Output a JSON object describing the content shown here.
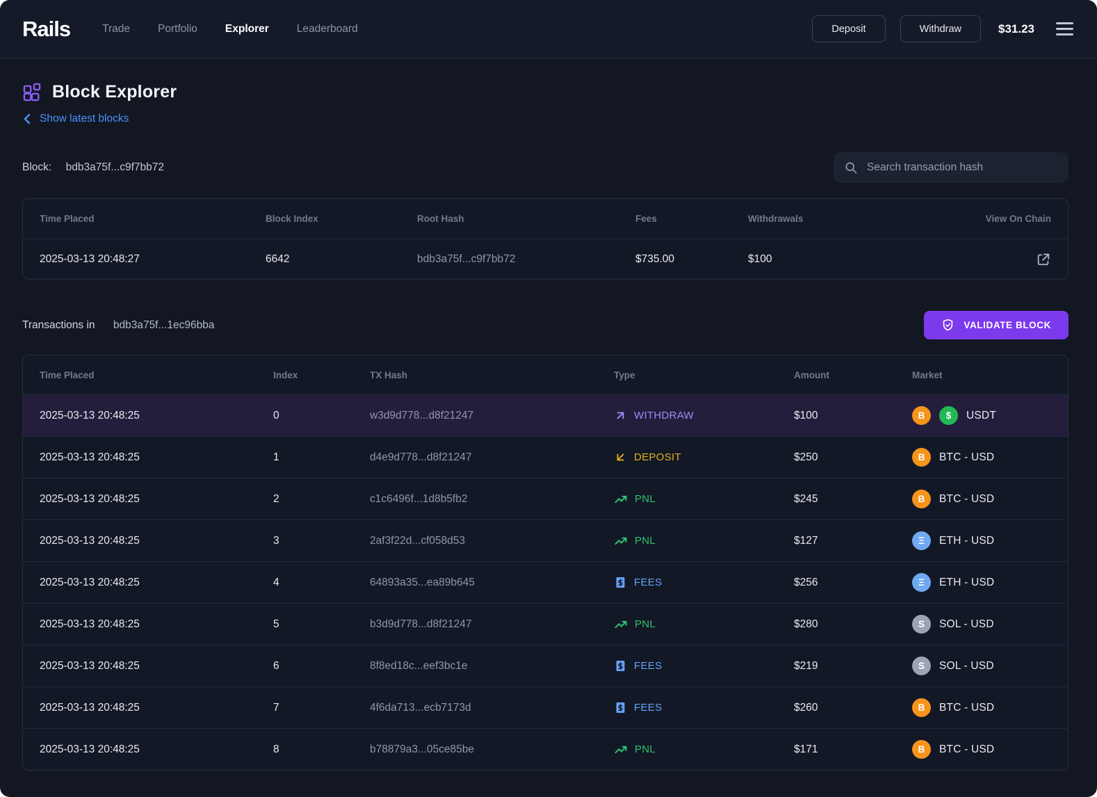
{
  "nav": {
    "logo": "Rails",
    "items": [
      {
        "label": "Trade",
        "active": false
      },
      {
        "label": "Portfolio",
        "active": false
      },
      {
        "label": "Explorer",
        "active": true
      },
      {
        "label": "Leaderboard",
        "active": false
      }
    ],
    "deposit_label": "Deposit",
    "withdraw_label": "Withdraw",
    "balance": "$31.23"
  },
  "page": {
    "title": "Block Explorer",
    "back_link": "Show latest blocks",
    "block_label": "Block:",
    "block_hash": "bdb3a75f...c9f7bb72",
    "search_placeholder": "Search transaction hash",
    "transactions_label": "Transactions in",
    "transactions_hash": "bdb3a75f...1ec96bba",
    "validate_button": "VALIDATE BLOCK"
  },
  "block_table": {
    "headers": [
      "Time Placed",
      "Block Index",
      "Root Hash",
      "Fees",
      "Withdrawals",
      "View On Chain"
    ],
    "row": {
      "time": "2025-03-13 20:48:27",
      "index": "6642",
      "root_hash": "bdb3a75f...c9f7bb72",
      "fees": "$735.00",
      "withdrawals": "$100"
    }
  },
  "tx_table": {
    "headers": [
      "Time Placed",
      "Index",
      "TX Hash",
      "Type",
      "Amount",
      "Market"
    ],
    "type_styles": {
      "WITHDRAW": {
        "color": "#9c8cfa",
        "icon": "arrow-up-right"
      },
      "DEPOSIT": {
        "color": "#e3b116",
        "icon": "arrow-down-left"
      },
      "PNL": {
        "color": "#2ec46f",
        "icon": "trending-up"
      },
      "FEES": {
        "color": "#66a3f7",
        "icon": "receipt-dollar"
      }
    },
    "coin_styles": {
      "btc": {
        "bg": "#f7941c",
        "glyph": "B"
      },
      "usdt": {
        "bg": "#21b954",
        "glyph": "$"
      },
      "eth": {
        "bg": "#70a9f2",
        "glyph": "Ξ"
      },
      "sol": {
        "bg": "#9ba4b5",
        "glyph": "S"
      }
    },
    "rows": [
      {
        "time": "2025-03-13 20:48:25",
        "index": "0",
        "hash": "w3d9d778...d8f21247",
        "type": "WITHDRAW",
        "amount": "$100",
        "market": "USDT",
        "coins": [
          "btc",
          "usdt"
        ],
        "highlighted": true
      },
      {
        "time": "2025-03-13 20:48:25",
        "index": "1",
        "hash": "d4e9d778...d8f21247",
        "type": "DEPOSIT",
        "amount": "$250",
        "market": "BTC - USD",
        "coins": [
          "btc"
        ],
        "highlighted": false
      },
      {
        "time": "2025-03-13 20:48:25",
        "index": "2",
        "hash": "c1c6496f...1d8b5fb2",
        "type": "PNL",
        "amount": "$245",
        "market": "BTC - USD",
        "coins": [
          "btc"
        ],
        "highlighted": false
      },
      {
        "time": "2025-03-13 20:48:25",
        "index": "3",
        "hash": "2af3f22d...cf058d53",
        "type": "PNL",
        "amount": "$127",
        "market": "ETH - USD",
        "coins": [
          "eth"
        ],
        "highlighted": false
      },
      {
        "time": "2025-03-13 20:48:25",
        "index": "4",
        "hash": "64893a35...ea89b645",
        "type": "FEES",
        "amount": "$256",
        "market": "ETH - USD",
        "coins": [
          "eth"
        ],
        "highlighted": false
      },
      {
        "time": "2025-03-13 20:48:25",
        "index": "5",
        "hash": "b3d9d778...d8f21247",
        "type": "PNL",
        "amount": "$280",
        "market": "SOL - USD",
        "coins": [
          "sol"
        ],
        "highlighted": false
      },
      {
        "time": "2025-03-13 20:48:25",
        "index": "6",
        "hash": "8f8ed18c...eef3bc1e",
        "type": "FEES",
        "amount": "$219",
        "market": "SOL - USD",
        "coins": [
          "sol"
        ],
        "highlighted": false
      },
      {
        "time": "2025-03-13 20:48:25",
        "index": "7",
        "hash": "4f6da713...ecb7173d",
        "type": "FEES",
        "amount": "$260",
        "market": "BTC - USD",
        "coins": [
          "btc"
        ],
        "highlighted": false
      },
      {
        "time": "2025-03-13 20:48:25",
        "index": "8",
        "hash": "b78879a3...05ce85be",
        "type": "PNL",
        "amount": "$171",
        "market": "BTC - USD",
        "coins": [
          "btc"
        ],
        "highlighted": false
      }
    ]
  },
  "colors": {
    "background": "#121722",
    "accent_purple": "#7c3aed",
    "link_blue": "#4f8ef7",
    "highlight_row": "#241e3c"
  }
}
